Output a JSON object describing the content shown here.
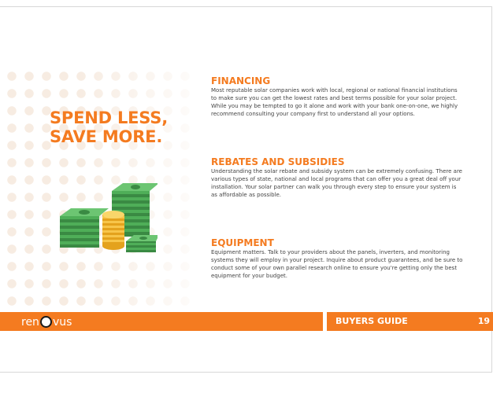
{
  "headline": {
    "line1": "SPEND LESS,",
    "line2": "SAVE MORE."
  },
  "sections": [
    {
      "title": "FINANCING",
      "body": "Most reputable solar companies work with local, regional or national financial institutions to make sure you can get the lowest rates and best terms possible for your solar project. While you may be tempted to go it alone and work with your bank one-on-one, we highly recommend consulting your company first to understand all your options."
    },
    {
      "title": "REBATES AND SUBSIDIES",
      "body": "Understanding the solar rebate and subsidy system can be extremely confusing. There are various types of state, national and local programs that can offer you a great deal off your installation. Your solar partner can walk you through every step to ensure your system is as affordable as possible."
    },
    {
      "title": "EQUIPMENT",
      "body": "Equipment matters. Talk to your providers about the panels, inverters, and monitoring systems they will employ in your project. Inquire about product guarantees, and be sure to conduct some of your own parallel research online to ensure you're getting only the best equipment for your budget."
    }
  ],
  "footer": {
    "logo_prefix": "ren",
    "logo_suffix": "vus",
    "label": "BUYERS GUIDE",
    "page_number": "19"
  },
  "colors": {
    "accent": "#f47b20",
    "money_green": "#3f9a4a",
    "coin_gold": "#f2b429"
  },
  "illustration": "money-stacks-and-coins-icon"
}
